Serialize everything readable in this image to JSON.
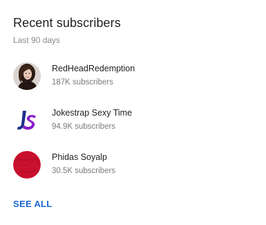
{
  "card": {
    "title": "Recent subscribers",
    "period": "Last 90 days",
    "see_all_label": "SEE ALL"
  },
  "subscribers": [
    {
      "name": "RedHeadRedemption",
      "subscriber_count": "187K subscribers",
      "avatar_icon": "portrait-photo-avatar"
    },
    {
      "name": "Jokestrap Sexy Time",
      "subscriber_count": "94.9K subscribers",
      "avatar_icon": "js-logo-avatar"
    },
    {
      "name": "Phidas Soyalp",
      "subscriber_count": "30.5K subscribers",
      "avatar_icon": "red-circle-avatar"
    }
  ],
  "colors": {
    "link": "#1a66d2",
    "js_navy": "#1e2f8c",
    "js_purple": "#8a1fc9",
    "red_avatar": "#c8102e"
  }
}
